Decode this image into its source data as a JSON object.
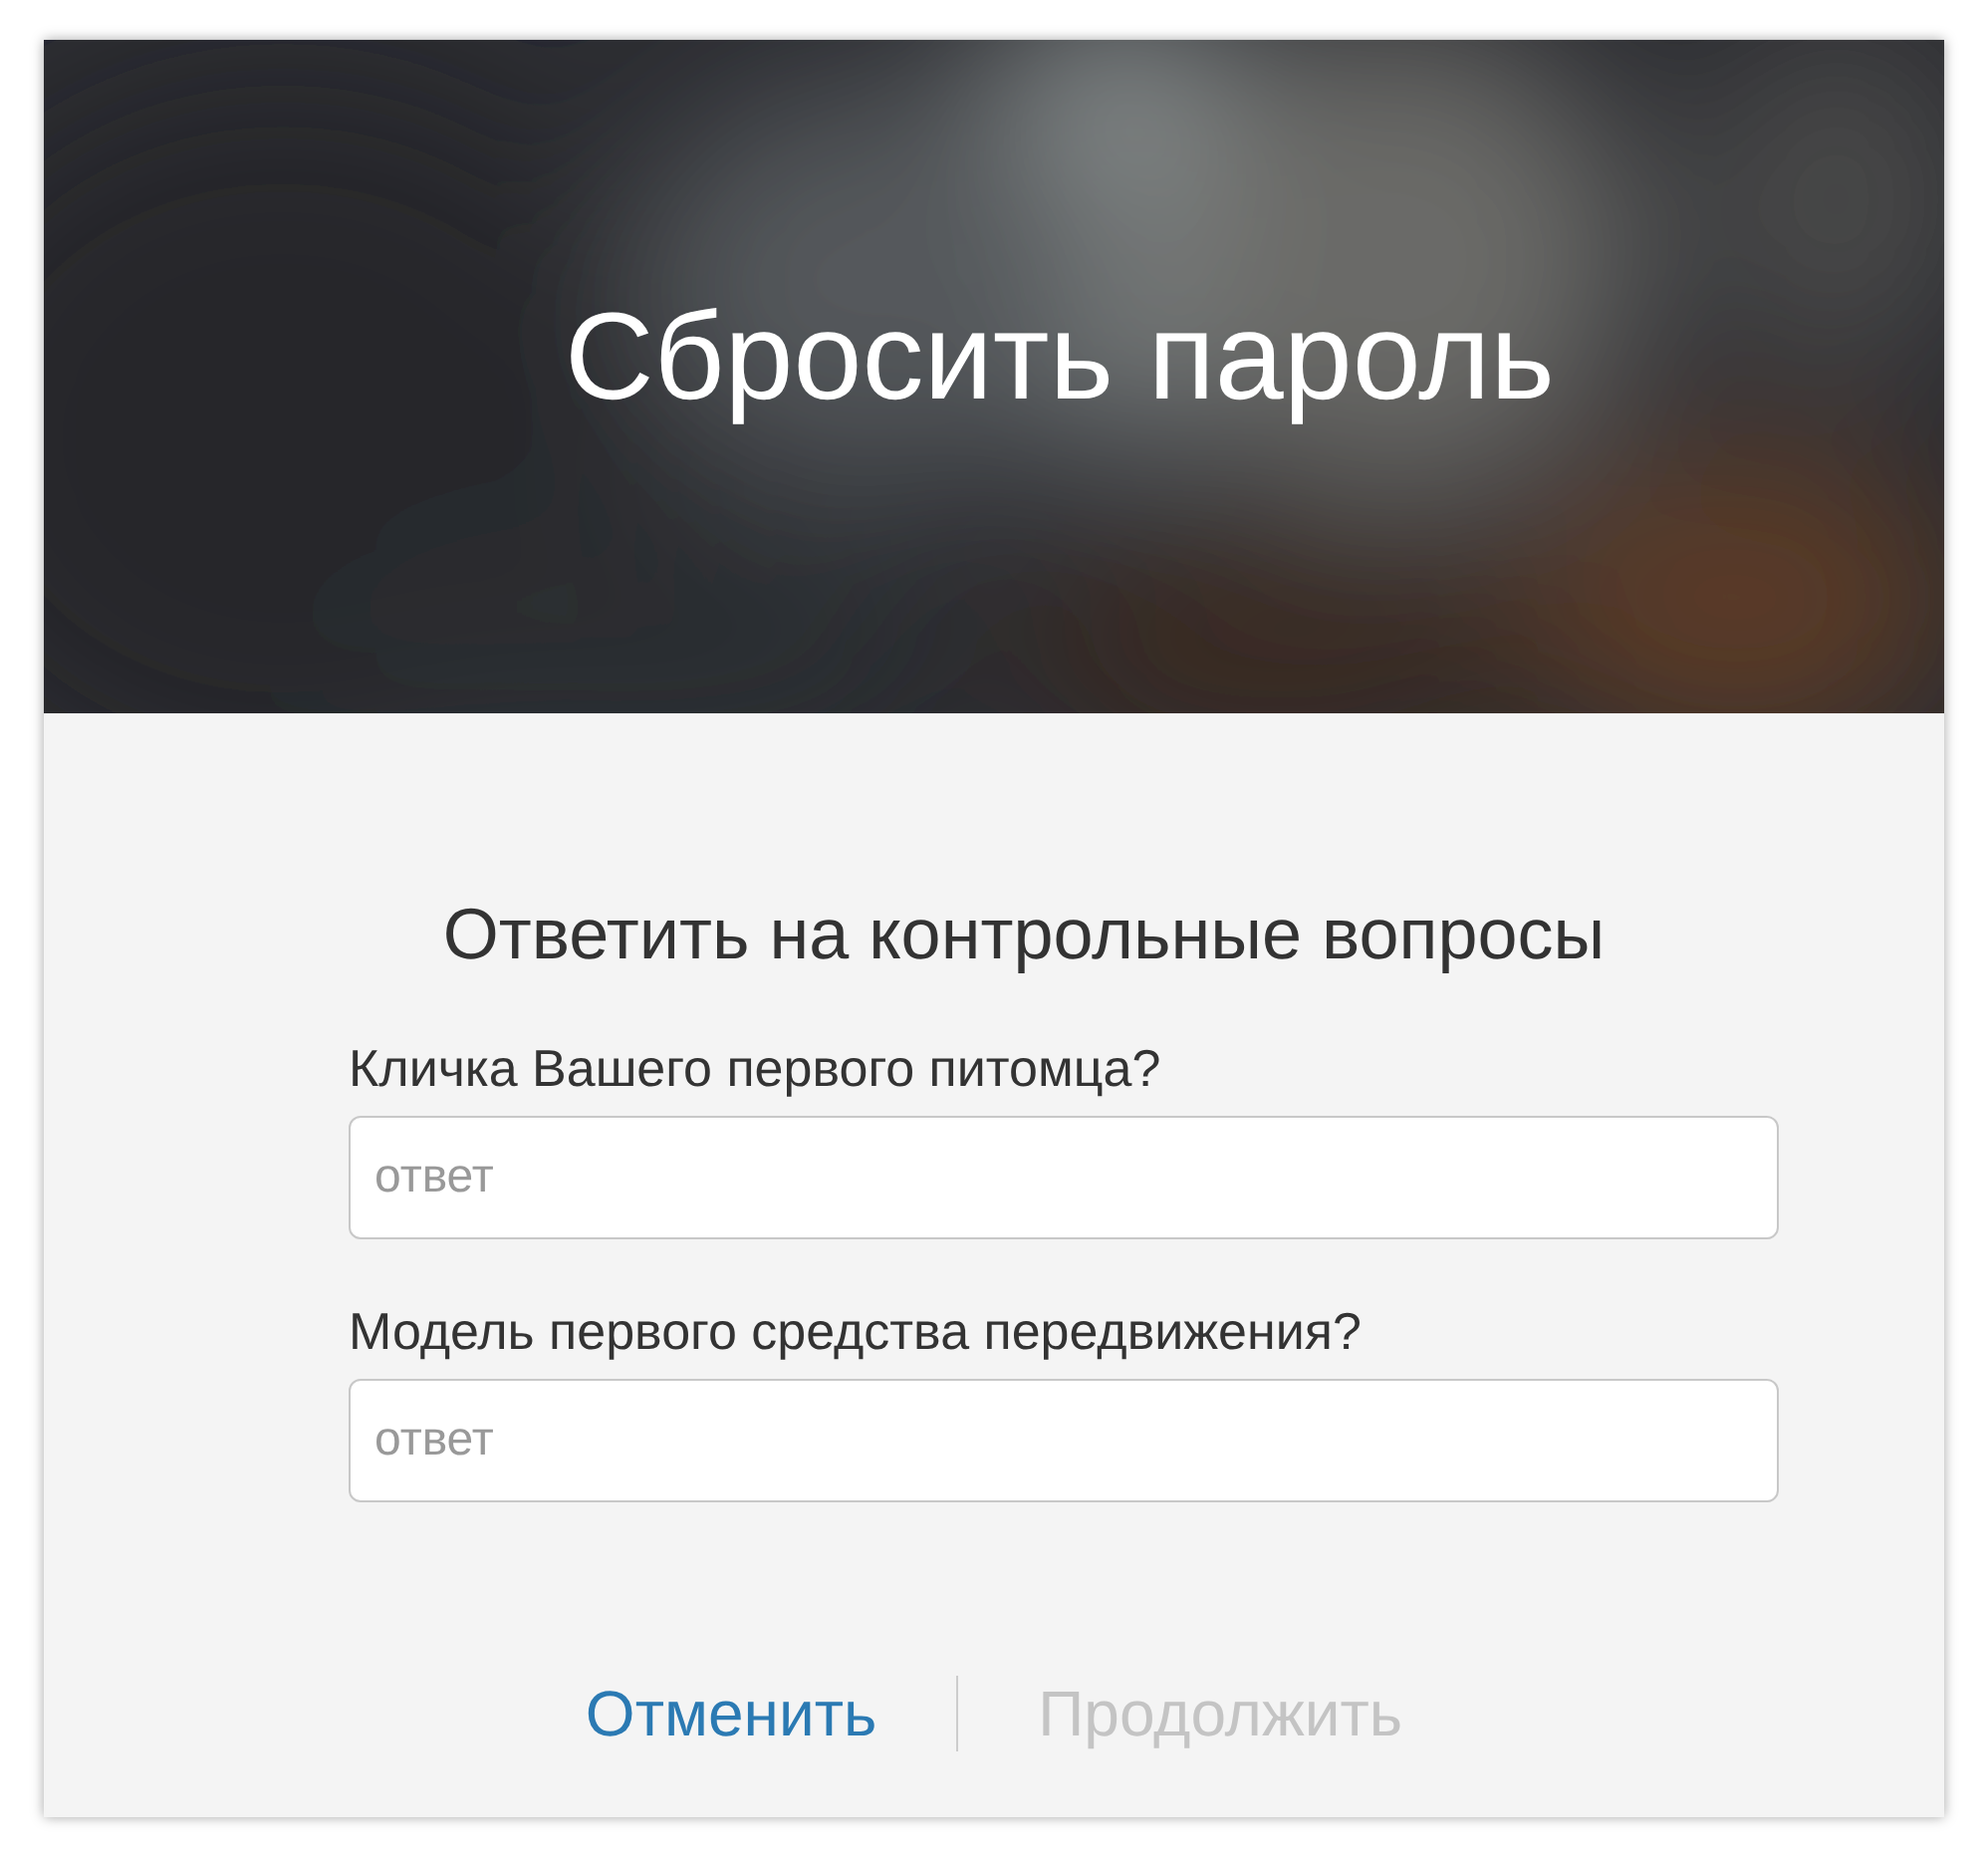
{
  "header": {
    "title": "Сбросить пароль",
    "kind": "picture"
  },
  "heading": "Ответить на контрольные вопросы",
  "questions": [
    {
      "label": "Кличка Вашего первого питомца?",
      "placeholder": "ответ"
    },
    {
      "label": "Модель первого средства передвижения?",
      "placeholder": "ответ"
    }
  ],
  "buttons": [
    {
      "label": "Отменить",
      "disabled": false
    },
    {
      "label": "Продолжить",
      "disabled": true
    }
  ]
}
